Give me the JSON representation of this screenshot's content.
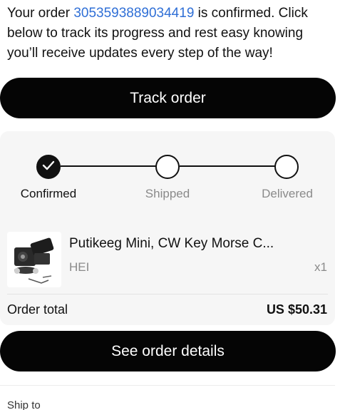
{
  "message": {
    "prefix": "Your order ",
    "order_number": "3053593889034419",
    "suffix": " is confirmed. Click below to track its progress and rest easy knowing you’ll receive updates every step of the way!"
  },
  "buttons": {
    "track_label": "Track order",
    "details_label": "See order details"
  },
  "tracking": {
    "steps": [
      {
        "label": "Confirmed",
        "done": true
      },
      {
        "label": "Shipped",
        "done": false
      },
      {
        "label": "Delivered",
        "done": false
      }
    ]
  },
  "product": {
    "title": "Putikeeg Mini, CW Key Morse C...",
    "variant": "HEI",
    "quantity": "x1"
  },
  "order_total": {
    "label": "Order total",
    "value": "US $50.31"
  },
  "ship_to": {
    "label": "Ship to"
  },
  "colors": {
    "link": "#2f6fd6",
    "button_bg": "#050505",
    "card_bg": "#f6f6f6"
  },
  "icons": [
    "checkmark-icon"
  ]
}
